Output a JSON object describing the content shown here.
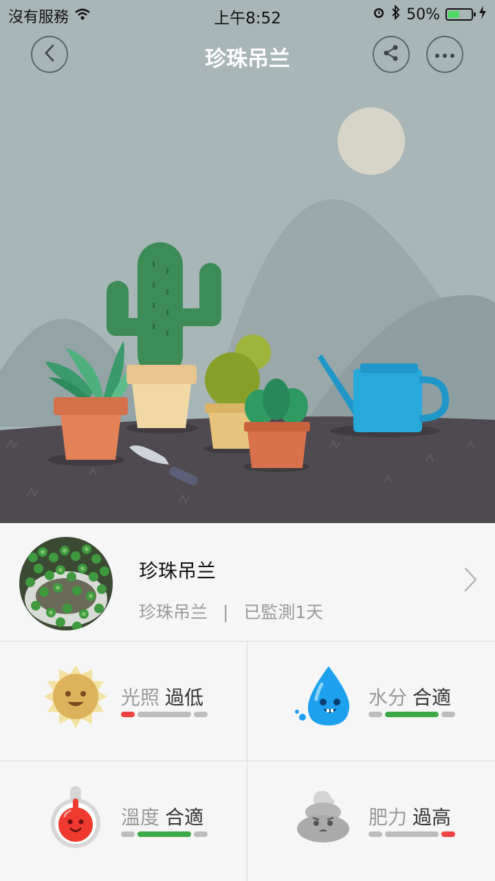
{
  "status_bar": {
    "carrier": "沒有服務",
    "time": "上午8:52",
    "battery_percent": "50%",
    "battery_level": 0.5
  },
  "nav": {
    "title": "珍珠吊兰",
    "back_icon": "chevron-left-icon",
    "share_icon": "share-icon",
    "more_icon": "more-icon"
  },
  "plant": {
    "name": "珍珠吊兰",
    "species": "珍珠吊兰",
    "separator": "|",
    "monitoring": "已監測1天"
  },
  "metrics": [
    {
      "label": "光照",
      "status": "過低",
      "icon": "sun-icon",
      "level": "low"
    },
    {
      "label": "水分",
      "status": "合適",
      "icon": "water-drop-icon",
      "level": "ok"
    },
    {
      "label": "溫度",
      "status": "合適",
      "icon": "thermometer-icon",
      "level": "ok"
    },
    {
      "label": "肥力",
      "status": "過高",
      "icon": "fertilizer-icon",
      "level": "high"
    }
  ],
  "colors": {
    "low_high": "#f24343",
    "ok": "#3daa48",
    "neutral": "#bdbdbd",
    "sky": "#a9b6b8",
    "ground": "#4e4a50"
  }
}
